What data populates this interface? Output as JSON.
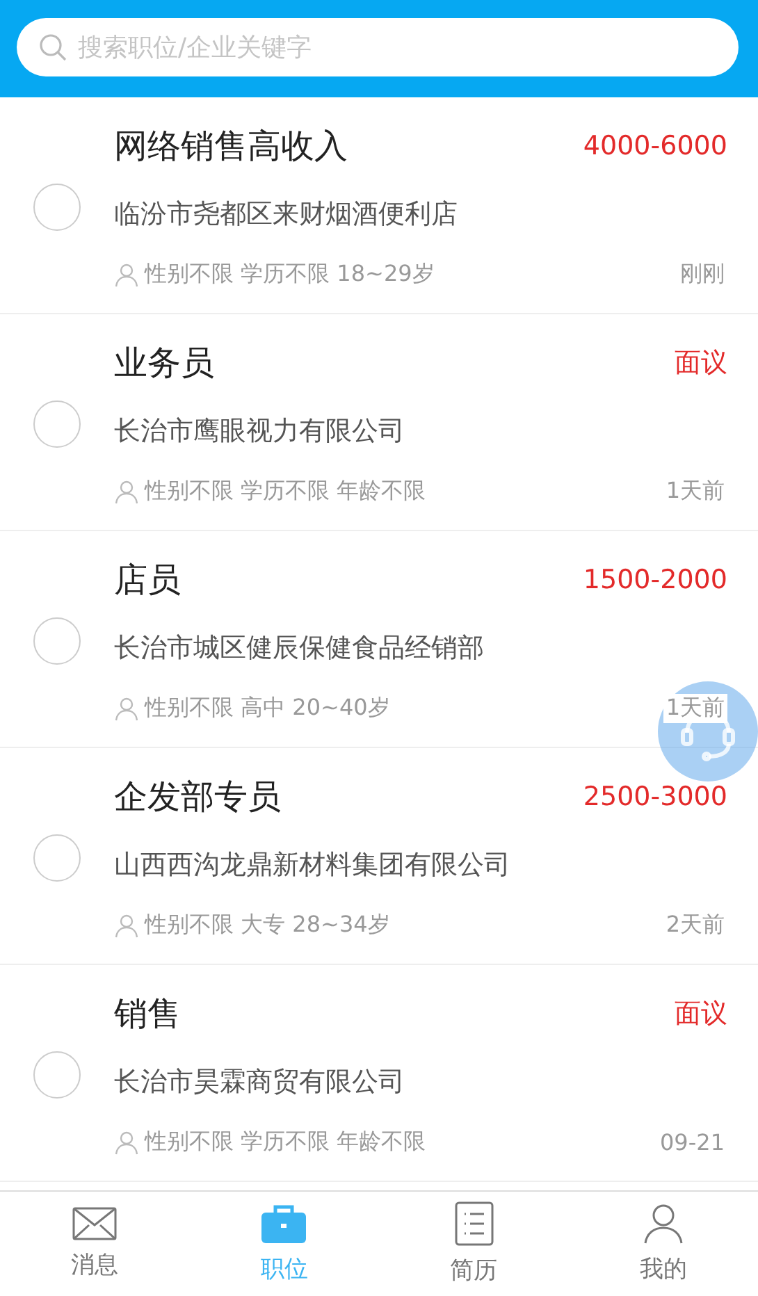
{
  "search": {
    "placeholder": "搜索职位/企业关键字"
  },
  "jobs": [
    {
      "title": "网络销售高收入",
      "salary": "4000-6000",
      "company": "临汾市尧都区来财烟酒便利店",
      "requirements": "性别不限 学历不限 18~29岁",
      "posted": "刚刚",
      "selected": false
    },
    {
      "title": "业务员",
      "salary": "面议",
      "company": "长治市鹰眼视力有限公司",
      "requirements": "性别不限 学历不限 年龄不限",
      "posted": "1天前",
      "selected": false
    },
    {
      "title": "店员",
      "salary": "1500-2000",
      "company": "长治市城区健辰保健食品经销部",
      "requirements": "性别不限 高中 20~40岁",
      "posted": "1天前",
      "selected": false
    },
    {
      "title": "企发部专员",
      "salary": "2500-3000",
      "company": "山西西沟龙鼎新材料集团有限公司",
      "requirements": "性别不限 大专 28~34岁",
      "posted": "2天前",
      "selected": false
    },
    {
      "title": "销售",
      "salary": "面议",
      "company": "长治市昊霖商贸有限公司",
      "requirements": "性别不限 学历不限 年龄不限",
      "posted": "09-21",
      "selected": false
    }
  ],
  "tabs": [
    {
      "label": "消息",
      "kind": "mail",
      "selected": false
    },
    {
      "label": "职位",
      "kind": "briefcase",
      "selected": true
    },
    {
      "label": "简历",
      "kind": "list",
      "selected": false
    },
    {
      "label": "我的",
      "kind": "person",
      "selected": false
    }
  ]
}
